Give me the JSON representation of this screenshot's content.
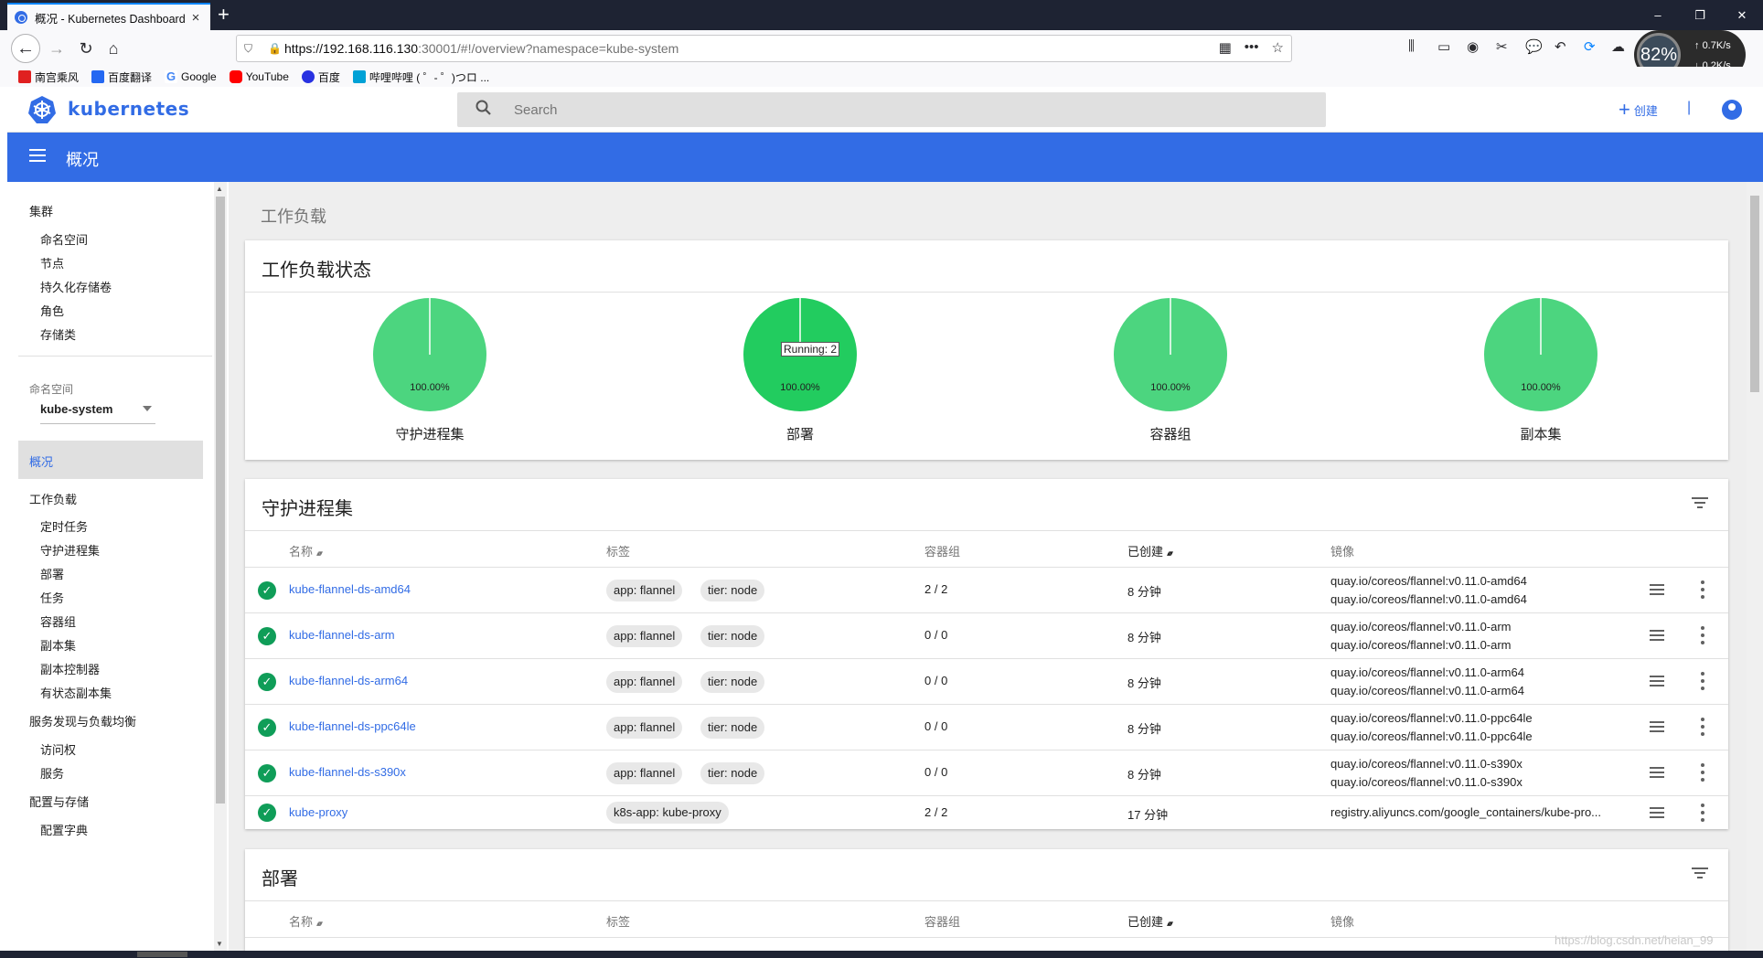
{
  "browser": {
    "tab_title": "概况 - Kubernetes Dashboard",
    "url_host": "https://192.168.116.130",
    "url_rest": ":30001/#!/overview?namespace=kube-system",
    "minimize": "–",
    "restore": "❐",
    "close": "✕",
    "netmon": {
      "percent": "82%",
      "up": "0.7K/s",
      "down": "0.2K/s"
    },
    "bookmarks": [
      {
        "label": "南宫乘风",
        "color": "#e02020"
      },
      {
        "label": "百度翻译",
        "color": "#2468f2"
      },
      {
        "label": "Google",
        "color": "#4285f4"
      },
      {
        "label": "YouTube",
        "color": "#ff0000"
      },
      {
        "label": "百度",
        "color": "#2932e1"
      },
      {
        "label": "哔哩哔哩 ( ゜- ゜)つロ ...",
        "color": "#00a1d6"
      }
    ]
  },
  "header": {
    "brand": "kubernetes",
    "search_placeholder": "Search",
    "create_label": "创建",
    "separator": "|"
  },
  "toolbar": {
    "title": "概况"
  },
  "sidebar": {
    "cluster": "集群",
    "cluster_items": [
      "命名空间",
      "节点",
      "持久化存储卷",
      "角色",
      "存储类"
    ],
    "namespace_caption": "命名空间",
    "namespace_value": "kube-system",
    "overview": "概况",
    "workloads": "工作负载",
    "workload_items": [
      "定时任务",
      "守护进程集",
      "部署",
      "任务",
      "容器组",
      "副本集",
      "副本控制器",
      "有状态副本集"
    ],
    "discovery": "服务发现与负载均衡",
    "discovery_items": [
      "访问权",
      "服务"
    ],
    "config": "配置与存储",
    "config_items": [
      "配置字典"
    ]
  },
  "main": {
    "page_title": "工作负载",
    "status_card": {
      "title": "工作负载状态",
      "pies": [
        {
          "label": "守护进程集",
          "percent": "100.00%",
          "color": "#4cd57f"
        },
        {
          "label": "部署",
          "percent": "100.00%",
          "color": "#22cc5f"
        },
        {
          "label": "容器组",
          "percent": "100.00%",
          "color": "#4cd57f"
        },
        {
          "label": "副本集",
          "percent": "100.00%",
          "color": "#4cd57f"
        }
      ],
      "tooltip": "Running: 2"
    },
    "daemonsets": {
      "title": "守护进程集",
      "columns": {
        "name": "名称",
        "labels": "标签",
        "pods": "容器组",
        "created": "已创建",
        "images": "镜像"
      },
      "rows": [
        {
          "name": "kube-flannel-ds-amd64",
          "labels": [
            "app: flannel",
            "tier: node"
          ],
          "pods": "2 / 2",
          "created": "8 分钟",
          "images": [
            "quay.io/coreos/flannel:v0.11.0-amd64",
            "quay.io/coreos/flannel:v0.11.0-amd64"
          ]
        },
        {
          "name": "kube-flannel-ds-arm",
          "labels": [
            "app: flannel",
            "tier: node"
          ],
          "pods": "0 / 0",
          "created": "8 分钟",
          "images": [
            "quay.io/coreos/flannel:v0.11.0-arm",
            "quay.io/coreos/flannel:v0.11.0-arm"
          ]
        },
        {
          "name": "kube-flannel-ds-arm64",
          "labels": [
            "app: flannel",
            "tier: node"
          ],
          "pods": "0 / 0",
          "created": "8 分钟",
          "images": [
            "quay.io/coreos/flannel:v0.11.0-arm64",
            "quay.io/coreos/flannel:v0.11.0-arm64"
          ]
        },
        {
          "name": "kube-flannel-ds-ppc64le",
          "labels": [
            "app: flannel",
            "tier: node"
          ],
          "pods": "0 / 0",
          "created": "8 分钟",
          "images": [
            "quay.io/coreos/flannel:v0.11.0-ppc64le",
            "quay.io/coreos/flannel:v0.11.0-ppc64le"
          ]
        },
        {
          "name": "kube-flannel-ds-s390x",
          "labels": [
            "app: flannel",
            "tier: node"
          ],
          "pods": "0 / 0",
          "created": "8 分钟",
          "images": [
            "quay.io/coreos/flannel:v0.11.0-s390x",
            "quay.io/coreos/flannel:v0.11.0-s390x"
          ]
        },
        {
          "name": "kube-proxy",
          "labels": [
            "k8s-app: kube-proxy"
          ],
          "pods": "2 / 2",
          "created": "17 分钟",
          "images": [
            "registry.aliyuncs.com/google_containers/kube-pro..."
          ]
        }
      ]
    },
    "deployments": {
      "title": "部署",
      "columns": {
        "name": "名称",
        "labels": "标签",
        "pods": "容器组",
        "created": "已创建",
        "images": "镜像"
      }
    }
  },
  "watermark": "https://blog.csdn.net/heian_99"
}
